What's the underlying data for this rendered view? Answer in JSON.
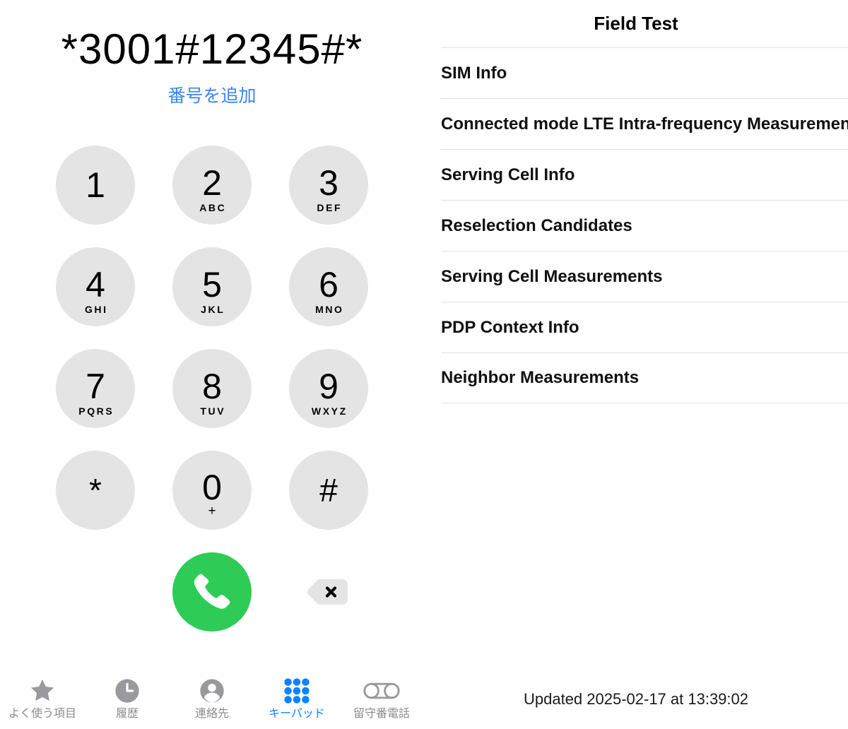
{
  "phone": {
    "dialed_number": "*3001#12345#*",
    "add_number_label": "番号を追加",
    "keypad": [
      [
        {
          "digit": "1",
          "letters": ""
        },
        {
          "digit": "2",
          "letters": "ABC"
        },
        {
          "digit": "3",
          "letters": "DEF"
        }
      ],
      [
        {
          "digit": "4",
          "letters": "GHI"
        },
        {
          "digit": "5",
          "letters": "JKL"
        },
        {
          "digit": "6",
          "letters": "MNO"
        }
      ],
      [
        {
          "digit": "7",
          "letters": "PQRS"
        },
        {
          "digit": "8",
          "letters": "TUV"
        },
        {
          "digit": "9",
          "letters": "WXYZ"
        }
      ],
      [
        {
          "digit": "*",
          "letters": ""
        },
        {
          "digit": "0",
          "letters": "+"
        },
        {
          "digit": "#",
          "letters": ""
        }
      ]
    ],
    "call_button": {
      "icon": "phone-handset-icon",
      "color": "#2ecc56"
    },
    "delete_button": {
      "icon": "backspace-icon",
      "glyph": "×"
    },
    "tabs": [
      {
        "label": "よく使う項目",
        "icon": "star-icon",
        "active": false
      },
      {
        "label": "履歴",
        "icon": "clock-icon",
        "active": false
      },
      {
        "label": "連絡先",
        "icon": "person-circle-icon",
        "active": false
      },
      {
        "label": "キーパッド",
        "icon": "keypad-grid-icon",
        "active": true
      },
      {
        "label": "留守番電話",
        "icon": "voicemail-icon",
        "active": false
      }
    ],
    "colors": {
      "accent_blue": "#0a84ff",
      "link_blue": "#3a86f0",
      "key_gray": "#e4e4e4",
      "call_green": "#2ecc56",
      "tab_inactive": "#8c8c90"
    }
  },
  "field_test": {
    "title": "Field Test",
    "rows": [
      {
        "label": "SIM Info"
      },
      {
        "label": "Connected mode LTE Intra-frequency Measurements"
      },
      {
        "label": "Serving Cell Info"
      },
      {
        "label": "Reselection Candidates"
      },
      {
        "label": "Serving Cell Measurements"
      },
      {
        "label": "PDP Context Info"
      },
      {
        "label": "Neighbor Measurements"
      }
    ],
    "updated_text": "Updated 2025-02-17 at 13:39:02",
    "colors": {
      "separator": "#e0e0e0",
      "chevron": "#c7c7cc"
    }
  }
}
